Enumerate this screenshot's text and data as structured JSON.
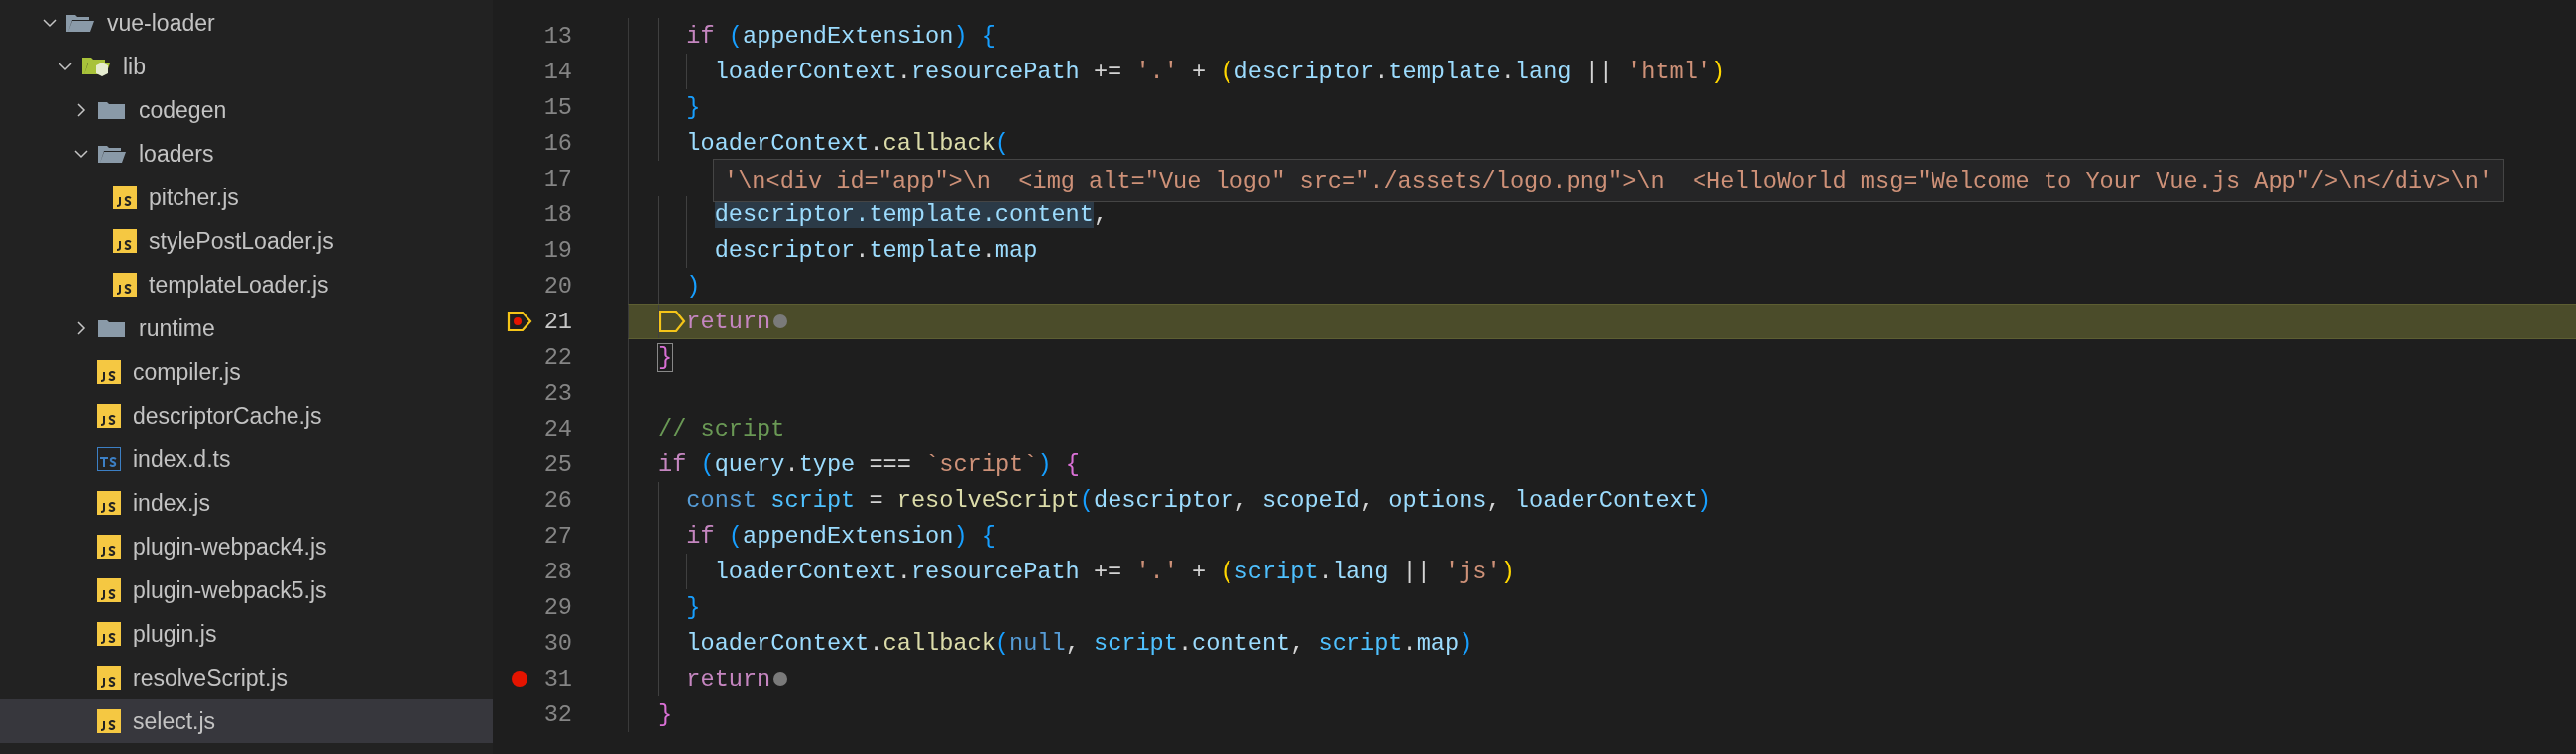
{
  "explorer": {
    "tree": [
      {
        "name": "vue-loader",
        "kind": "folder",
        "expanded": true,
        "selected": false,
        "children": [
          {
            "name": "lib",
            "kind": "lib-folder",
            "expanded": true,
            "selected": false,
            "children": [
              {
                "name": "codegen",
                "kind": "folder",
                "expanded": false,
                "selected": false
              },
              {
                "name": "loaders",
                "kind": "folder",
                "expanded": true,
                "selected": false,
                "children": [
                  {
                    "name": "pitcher.js",
                    "kind": "js",
                    "selected": false
                  },
                  {
                    "name": "stylePostLoader.js",
                    "kind": "js",
                    "selected": false
                  },
                  {
                    "name": "templateLoader.js",
                    "kind": "js",
                    "selected": false
                  }
                ]
              },
              {
                "name": "runtime",
                "kind": "folder",
                "expanded": false,
                "selected": false
              },
              {
                "name": "compiler.js",
                "kind": "js",
                "selected": false
              },
              {
                "name": "descriptorCache.js",
                "kind": "js",
                "selected": false
              },
              {
                "name": "index.d.ts",
                "kind": "ts",
                "selected": false
              },
              {
                "name": "index.js",
                "kind": "js",
                "selected": false
              },
              {
                "name": "plugin-webpack4.js",
                "kind": "js",
                "selected": false
              },
              {
                "name": "plugin-webpack5.js",
                "kind": "js",
                "selected": false
              },
              {
                "name": "plugin.js",
                "kind": "js",
                "selected": false
              },
              {
                "name": "resolveScript.js",
                "kind": "js",
                "selected": false
              },
              {
                "name": "select.js",
                "kind": "js",
                "selected": true
              }
            ]
          }
        ]
      }
    ]
  },
  "editor": {
    "lines": [
      {
        "number": "13",
        "tokens": [
          {
            "kind": "keyword",
            "text": "  if"
          },
          {
            "kind": "b2",
            "text": " ("
          },
          {
            "kind": "var",
            "text": "appendExtension"
          },
          {
            "kind": "b2",
            "text": ")"
          },
          {
            "kind": "b2",
            "text": " {"
          }
        ]
      },
      {
        "number": "14",
        "tokens": [
          {
            "kind": "var",
            "text": "    loaderContext"
          },
          {
            "kind": "plain",
            "text": "."
          },
          {
            "kind": "var",
            "text": "resourcePath"
          },
          {
            "kind": "plain",
            "text": " += "
          },
          {
            "kind": "string",
            "text": "'.'"
          },
          {
            "kind": "plain",
            "text": " + "
          },
          {
            "kind": "b3",
            "text": "("
          },
          {
            "kind": "var",
            "text": "descriptor"
          },
          {
            "kind": "plain",
            "text": "."
          },
          {
            "kind": "var",
            "text": "template"
          },
          {
            "kind": "plain",
            "text": "."
          },
          {
            "kind": "var",
            "text": "lang"
          },
          {
            "kind": "plain",
            "text": " || "
          },
          {
            "kind": "string",
            "text": "'html'"
          },
          {
            "kind": "b3",
            "text": ")"
          }
        ]
      },
      {
        "number": "15",
        "tokens": [
          {
            "kind": "b2",
            "text": "  }"
          }
        ]
      },
      {
        "number": "16",
        "tokens": [
          {
            "kind": "var",
            "text": "  loaderContext"
          },
          {
            "kind": "plain",
            "text": "."
          },
          {
            "kind": "function",
            "text": "callback"
          },
          {
            "kind": "b2",
            "text": "("
          }
        ]
      },
      {
        "number": "17"
      },
      {
        "number": "18",
        "tokens": [
          {
            "kind": "var",
            "text": "    descriptor.template.content",
            "highlighted": true
          },
          {
            "kind": "plain",
            "text": ","
          }
        ]
      },
      {
        "number": "19",
        "tokens": [
          {
            "kind": "var",
            "text": "    descriptor"
          },
          {
            "kind": "plain",
            "text": "."
          },
          {
            "kind": "var",
            "text": "template"
          },
          {
            "kind": "plain",
            "text": "."
          },
          {
            "kind": "var",
            "text": "map"
          }
        ]
      },
      {
        "number": "20",
        "tokens": [
          {
            "kind": "b2",
            "text": "  )"
          }
        ]
      },
      {
        "number": "21",
        "paused": true,
        "inline_breakpoint": true,
        "tokens": [
          {
            "kind": "keyword",
            "text": "return"
          }
        ]
      },
      {
        "number": "22",
        "tokens": [
          {
            "kind": "b1",
            "text": "}",
            "matched": true
          }
        ]
      },
      {
        "number": "23"
      },
      {
        "number": "24",
        "tokens": [
          {
            "kind": "comment",
            "text": "// script"
          }
        ]
      },
      {
        "number": "25",
        "tokens": [
          {
            "kind": "keyword",
            "text": "if"
          },
          {
            "kind": "b2",
            "text": " ("
          },
          {
            "kind": "var",
            "text": "query"
          },
          {
            "kind": "plain",
            "text": "."
          },
          {
            "kind": "var",
            "text": "type"
          },
          {
            "kind": "plain",
            "text": " === "
          },
          {
            "kind": "string",
            "text": "`script`"
          },
          {
            "kind": "b2",
            "text": ")"
          },
          {
            "kind": "b1",
            "text": " {"
          }
        ]
      },
      {
        "number": "26",
        "tokens": [
          {
            "kind": "storage",
            "text": "  const"
          },
          {
            "kind": "const",
            "text": " script"
          },
          {
            "kind": "plain",
            "text": " = "
          },
          {
            "kind": "function",
            "text": "resolveScript"
          },
          {
            "kind": "b2",
            "text": "("
          },
          {
            "kind": "var",
            "text": "descriptor"
          },
          {
            "kind": "plain",
            "text": ", "
          },
          {
            "kind": "var",
            "text": "scopeId"
          },
          {
            "kind": "plain",
            "text": ", "
          },
          {
            "kind": "var",
            "text": "options"
          },
          {
            "kind": "plain",
            "text": ", "
          },
          {
            "kind": "var",
            "text": "loaderContext"
          },
          {
            "kind": "b2",
            "text": ")"
          }
        ]
      },
      {
        "number": "27",
        "tokens": [
          {
            "kind": "keyword",
            "text": "  if"
          },
          {
            "kind": "b2",
            "text": " ("
          },
          {
            "kind": "var",
            "text": "appendExtension"
          },
          {
            "kind": "b2",
            "text": ")"
          },
          {
            "kind": "b2",
            "text": " {"
          }
        ]
      },
      {
        "number": "28",
        "tokens": [
          {
            "kind": "var",
            "text": "    loaderContext"
          },
          {
            "kind": "plain",
            "text": "."
          },
          {
            "kind": "var",
            "text": "resourcePath"
          },
          {
            "kind": "plain",
            "text": " += "
          },
          {
            "kind": "string",
            "text": "'.'"
          },
          {
            "kind": "plain",
            "text": " + "
          },
          {
            "kind": "b3",
            "text": "("
          },
          {
            "kind": "const",
            "text": "script"
          },
          {
            "kind": "plain",
            "text": "."
          },
          {
            "kind": "var",
            "text": "lang"
          },
          {
            "kind": "plain",
            "text": " || "
          },
          {
            "kind": "string",
            "text": "'js'"
          },
          {
            "kind": "b3",
            "text": ")"
          }
        ]
      },
      {
        "number": "29",
        "tokens": [
          {
            "kind": "b2",
            "text": "  }"
          }
        ]
      },
      {
        "number": "30",
        "tokens": [
          {
            "kind": "var",
            "text": "  loaderContext"
          },
          {
            "kind": "plain",
            "text": "."
          },
          {
            "kind": "function",
            "text": "callback"
          },
          {
            "kind": "b2",
            "text": "("
          },
          {
            "kind": "storage",
            "text": "null"
          },
          {
            "kind": "plain",
            "text": ", "
          },
          {
            "kind": "const",
            "text": "script"
          },
          {
            "kind": "plain",
            "text": "."
          },
          {
            "kind": "var",
            "text": "content"
          },
          {
            "kind": "plain",
            "text": ", "
          },
          {
            "kind": "const",
            "text": "script"
          },
          {
            "kind": "plain",
            "text": "."
          },
          {
            "kind": "var",
            "text": "map"
          },
          {
            "kind": "b2",
            "text": ")"
          }
        ]
      },
      {
        "number": "31",
        "breakpoint": true,
        "inline_breakpoint": true,
        "tokens": [
          {
            "kind": "keyword",
            "text": "  return"
          }
        ]
      },
      {
        "number": "32",
        "tokens": [
          {
            "kind": "b1",
            "text": "}"
          }
        ]
      }
    ],
    "hover": {
      "value": "'\\n<div id=\"app\">\\n  <img alt=\"Vue logo\" src=\"./assets/logo.png\">\\n  <HelloWorld msg=\"Welcome to Your Vue.js App\"/>\\n</div>\\n'"
    }
  }
}
